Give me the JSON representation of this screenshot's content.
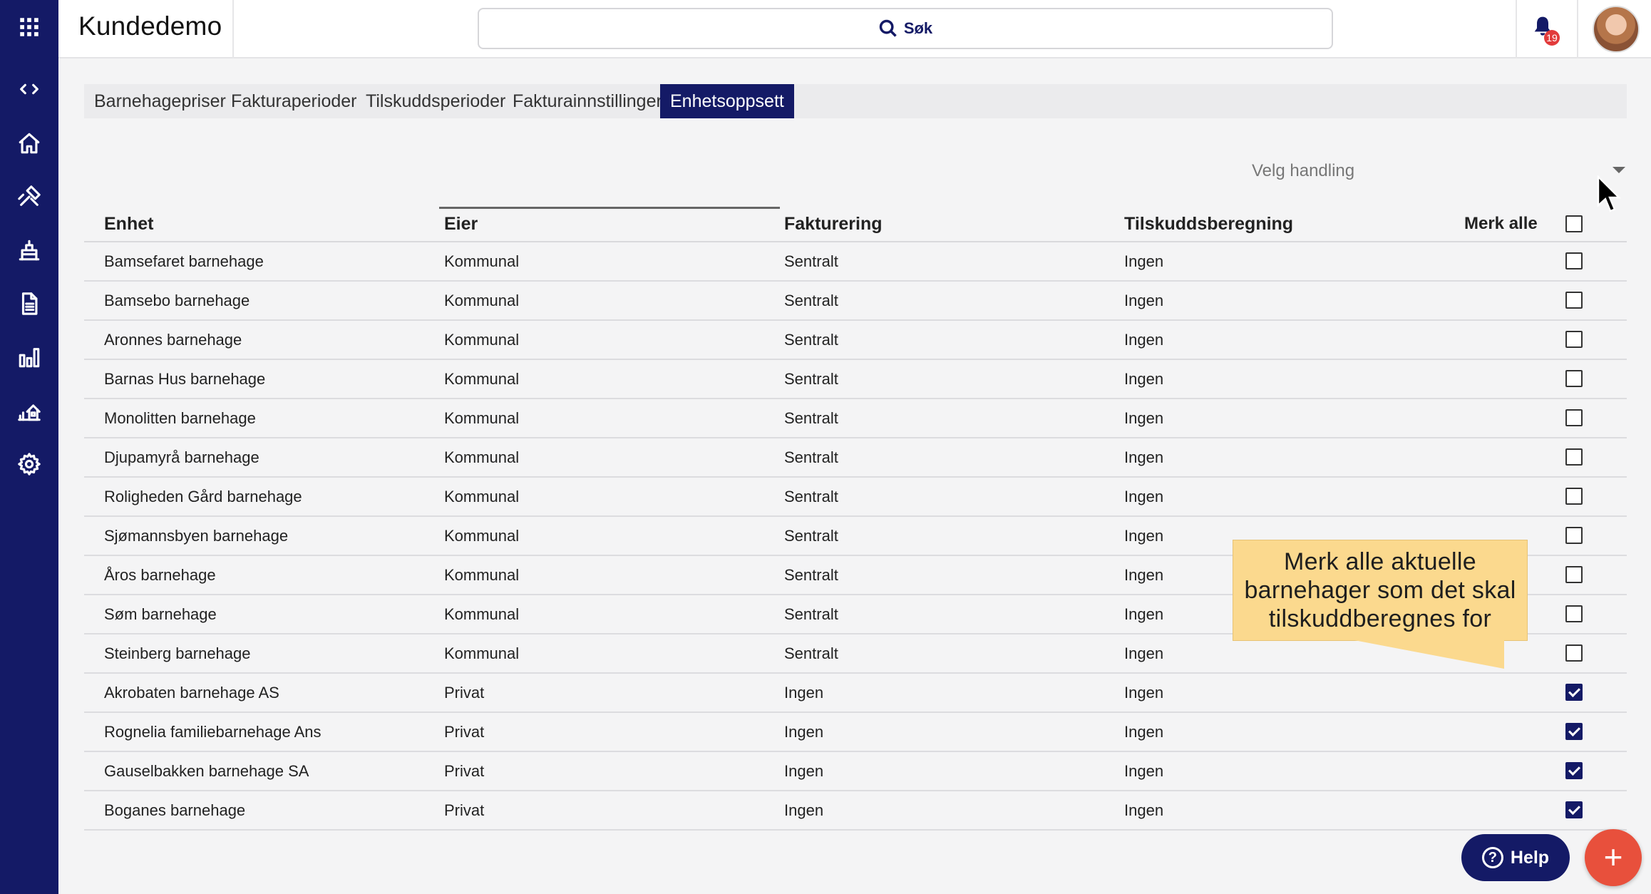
{
  "app": {
    "title": "Kundedemo"
  },
  "search": {
    "label": "Søk",
    "icon": "search-icon"
  },
  "notifications": {
    "count": "19",
    "icon": "bell-icon"
  },
  "sidebar": {
    "items": [
      {
        "name": "apps",
        "icon": "grid-icon"
      },
      {
        "name": "toggle",
        "icon": "code-brackets-icon"
      },
      {
        "name": "home",
        "icon": "home-icon"
      },
      {
        "name": "tools",
        "icon": "tools-icon"
      },
      {
        "name": "units",
        "icon": "building-icon"
      },
      {
        "name": "documents",
        "icon": "document-icon"
      },
      {
        "name": "reports",
        "icon": "bar-chart-icon"
      },
      {
        "name": "property",
        "icon": "house-chart-icon"
      },
      {
        "name": "settings",
        "icon": "gear-icon"
      }
    ]
  },
  "tabs": [
    {
      "label": "Barnehagepriser",
      "active": false
    },
    {
      "label": "Fakturaperioder",
      "active": false
    },
    {
      "label": "Tilskuddsperioder",
      "active": false
    },
    {
      "label": "Fakturainnstillinger",
      "active": false
    },
    {
      "label": "Enhetsoppsett",
      "active": true
    }
  ],
  "action": {
    "placeholder": "Velg handling"
  },
  "table": {
    "headers": [
      "Enhet",
      "Eier",
      "Fakturering",
      "Tilskuddsberegning"
    ],
    "select_all_label": "Merk alle",
    "rows": [
      {
        "enhet": "Bamsefaret barnehage",
        "eier": "Kommunal",
        "fakturering": "Sentralt",
        "tilskudd": "Ingen",
        "checked": false
      },
      {
        "enhet": "Bamsebo barnehage",
        "eier": "Kommunal",
        "fakturering": "Sentralt",
        "tilskudd": "Ingen",
        "checked": false
      },
      {
        "enhet": "Aronnes barnehage",
        "eier": "Kommunal",
        "fakturering": "Sentralt",
        "tilskudd": "Ingen",
        "checked": false
      },
      {
        "enhet": "Barnas Hus barnehage",
        "eier": "Kommunal",
        "fakturering": "Sentralt",
        "tilskudd": "Ingen",
        "checked": false
      },
      {
        "enhet": "Monolitten barnehage",
        "eier": "Kommunal",
        "fakturering": "Sentralt",
        "tilskudd": "Ingen",
        "checked": false
      },
      {
        "enhet": "Djupamyrå barnehage",
        "eier": "Kommunal",
        "fakturering": "Sentralt",
        "tilskudd": "Ingen",
        "checked": false
      },
      {
        "enhet": "Roligheden Gård barnehage",
        "eier": "Kommunal",
        "fakturering": "Sentralt",
        "tilskudd": "Ingen",
        "checked": false
      },
      {
        "enhet": "Sjømannsbyen barnehage",
        "eier": "Kommunal",
        "fakturering": "Sentralt",
        "tilskudd": "Ingen",
        "checked": false
      },
      {
        "enhet": "Åros barnehage",
        "eier": "Kommunal",
        "fakturering": "Sentralt",
        "tilskudd": "Ingen",
        "checked": false
      },
      {
        "enhet": "Søm barnehage",
        "eier": "Kommunal",
        "fakturering": "Sentralt",
        "tilskudd": "Ingen",
        "checked": false
      },
      {
        "enhet": "Steinberg barnehage",
        "eier": "Kommunal",
        "fakturering": "Sentralt",
        "tilskudd": "Ingen",
        "checked": false
      },
      {
        "enhet": "Akrobaten barnehage AS",
        "eier": "Privat",
        "fakturering": "Ingen",
        "tilskudd": "Ingen",
        "checked": true
      },
      {
        "enhet": "Rognelia familiebarnehage Ans",
        "eier": "Privat",
        "fakturering": "Ingen",
        "tilskudd": "Ingen",
        "checked": true
      },
      {
        "enhet": "Gauselbakken barnehage SA",
        "eier": "Privat",
        "fakturering": "Ingen",
        "tilskudd": "Ingen",
        "checked": true
      },
      {
        "enhet": "Boganes barnehage",
        "eier": "Privat",
        "fakturering": "Ingen",
        "tilskudd": "Ingen",
        "checked": true
      }
    ]
  },
  "callout": {
    "lines": [
      "Merk alle aktuelle",
      "barnehager som det skal",
      "tilskuddberegnes  for"
    ]
  },
  "help": {
    "label": "Help",
    "icon_glyph": "?"
  },
  "fab": {
    "glyph": "+"
  },
  "colors": {
    "primary": "#141a66",
    "accent": "#e8503c",
    "callout": "#fbd98e"
  }
}
